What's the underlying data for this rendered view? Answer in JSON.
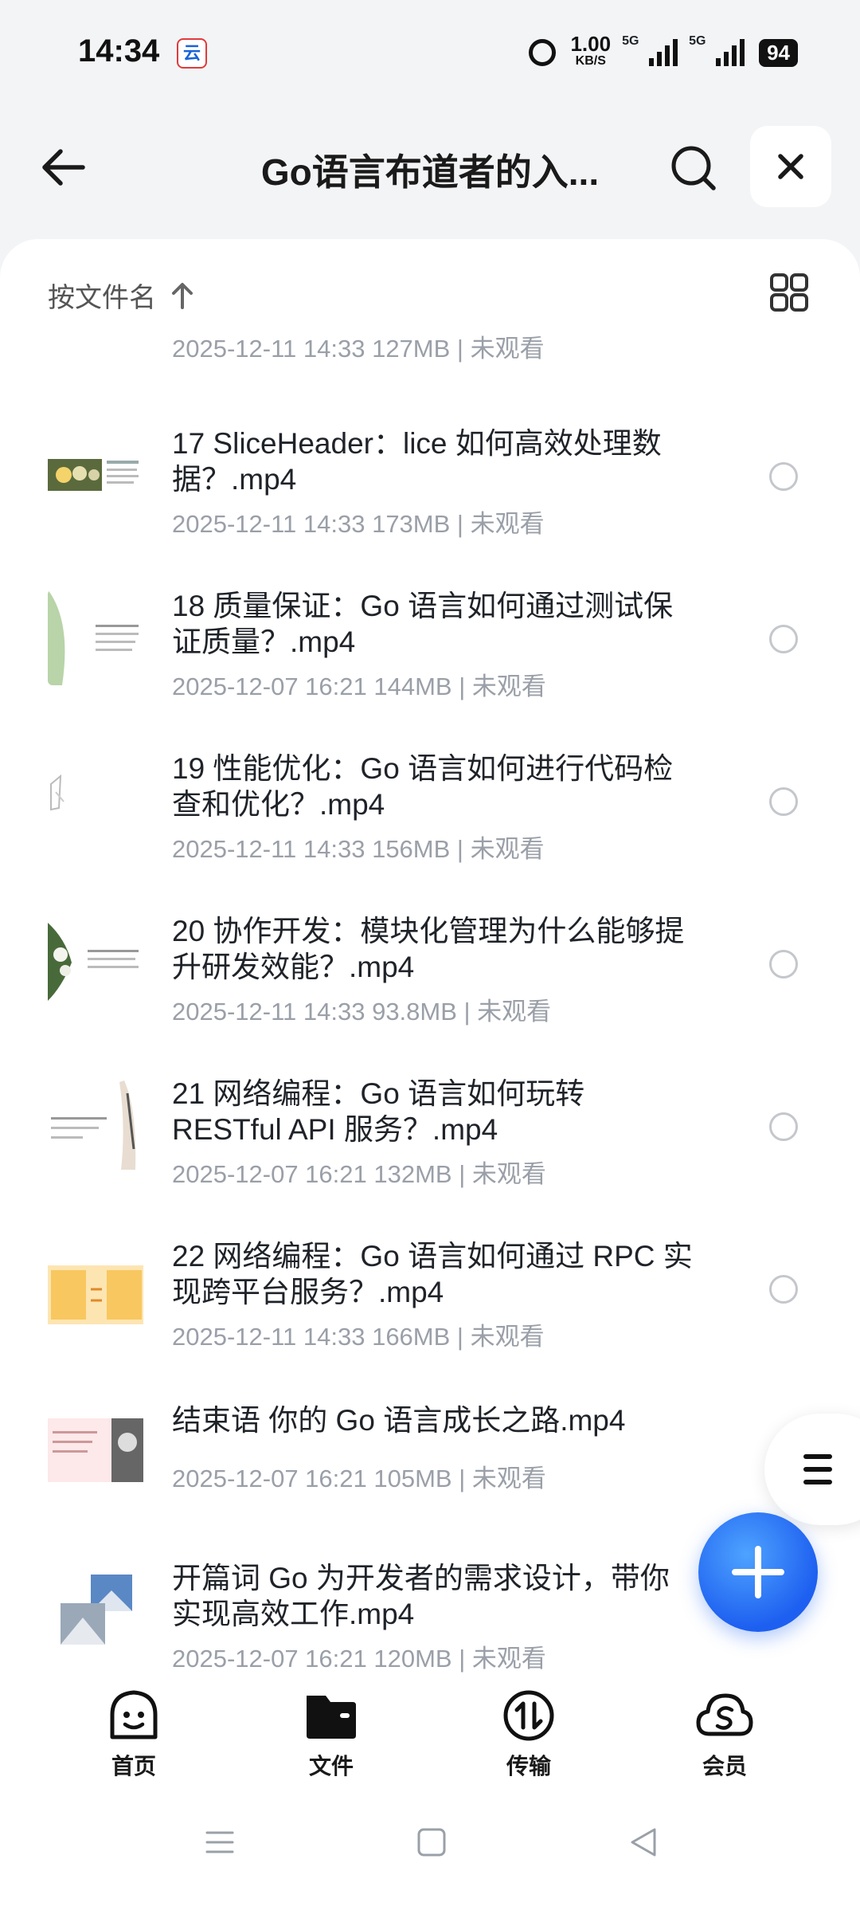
{
  "status_bar": {
    "time": "14:34",
    "net_speed": "1.00",
    "net_unit": "KB/S",
    "sim1": "5G",
    "sim2": "5G",
    "battery": "94"
  },
  "header": {
    "title": "Go语言布道者的入..."
  },
  "sort": {
    "label": "按文件名"
  },
  "files": [
    {
      "name": "",
      "meta": "2025-12-11 14:33  127MB | 未观看"
    },
    {
      "name": "17  SliceHeader：lice 如何高效处理数据？.mp4",
      "meta": "2025-12-11 14:33  173MB | 未观看"
    },
    {
      "name": "18  质量保证：Go 语言如何通过测试保证质量？.mp4",
      "meta": "2025-12-07 16:21  144MB | 未观看"
    },
    {
      "name": "19  性能优化：Go 语言如何进行代码检查和优化？.mp4",
      "meta": "2025-12-11 14:33  156MB | 未观看"
    },
    {
      "name": "20  协作开发：模块化管理为什么能够提升研发效能？.mp4",
      "meta": "2025-12-11 14:33  93.8MB | 未观看"
    },
    {
      "name": "21  网络编程：Go 语言如何玩转 RESTful API 服务？.mp4",
      "meta": "2025-12-07 16:21  132MB | 未观看"
    },
    {
      "name": "22  网络编程：Go 语言如何通过 RPC 实现跨平台服务？.mp4",
      "meta": "2025-12-11 14:33  166MB | 未观看"
    },
    {
      "name": "结束语  你的 Go 语言成长之路.mp4",
      "meta": "2025-12-07 16:21  105MB | 未观看"
    },
    {
      "name": "开篇词  Go 为开发者的需求设计，带你实现高效工作.mp4",
      "meta": "2025-12-07 16:21  120MB | 未观看"
    }
  ],
  "nav": {
    "home": "首页",
    "files": "文件",
    "transfer": "传输",
    "vip": "会员"
  },
  "colors": {
    "accent": "#1d5ff0",
    "text_primary": "#1f2329",
    "text_meta": "#9a9fa8"
  }
}
